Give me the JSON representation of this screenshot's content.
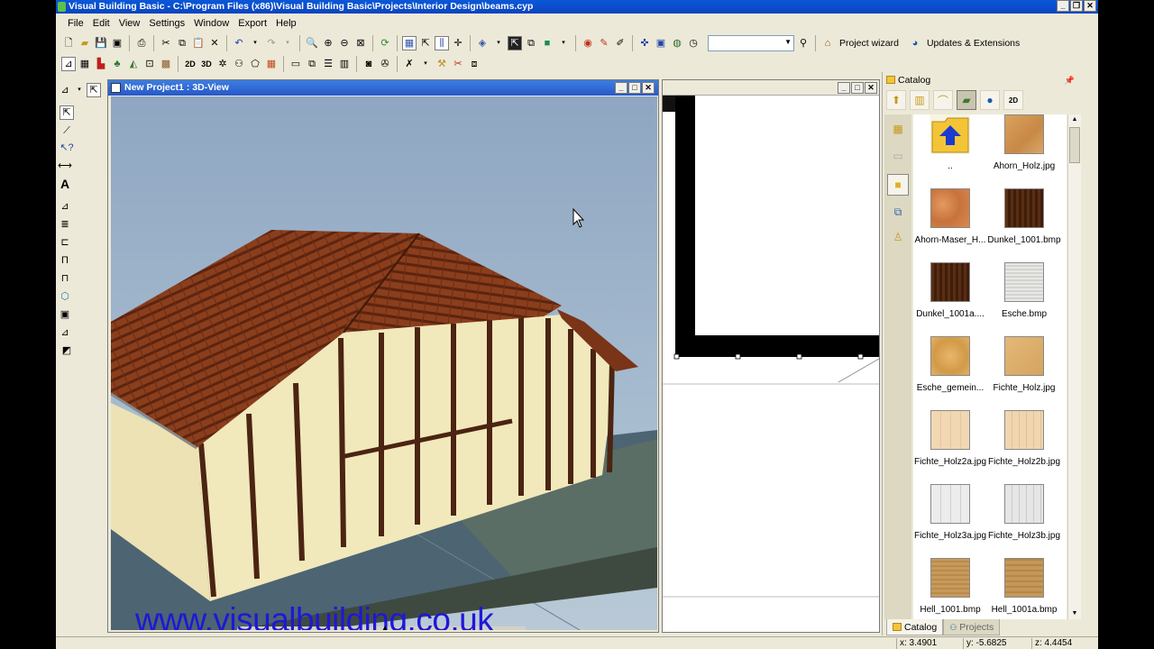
{
  "window": {
    "title": "Visual Building Basic - C:\\Program Files (x86)\\Visual Building Basic\\Projects\\Interior Design\\beams.cyp"
  },
  "menu": [
    "File",
    "Edit",
    "View",
    "Settings",
    "Window",
    "Export",
    "Help"
  ],
  "toolbar": {
    "project_wizard": "Project wizard",
    "updates": "Updates & Extensions",
    "combo_value": ""
  },
  "view3d": {
    "title": "New Project1 : 3D-View"
  },
  "watermark": "www.visualbuilding.co.uk",
  "catalog": {
    "title": "Catalog",
    "items": [
      {
        "label": "..",
        "icon": "folder-up-icon"
      },
      {
        "label": "Ahorn_Holz.jpg"
      },
      {
        "label": "Ahorn-Maser_H..."
      },
      {
        "label": "Dunkel_1001.bmp"
      },
      {
        "label": "Dunkel_1001a...."
      },
      {
        "label": "Esche.bmp"
      },
      {
        "label": "Esche_gemein..."
      },
      {
        "label": "Fichte_Holz.jpg"
      },
      {
        "label": "Fichte_Holz2a.jpg"
      },
      {
        "label": "Fichte_Holz2b.jpg"
      },
      {
        "label": "Fichte_Holz3a.jpg"
      },
      {
        "label": "Fichte_Holz3b.jpg"
      },
      {
        "label": "Hell_1001.bmp"
      },
      {
        "label": "Hell_1001a.bmp"
      }
    ],
    "tabs": [
      "Catalog",
      "Projects"
    ]
  },
  "status": {
    "x": "x: 3.4901",
    "y": "y: -5.6825",
    "z": "z: 4.4454"
  }
}
